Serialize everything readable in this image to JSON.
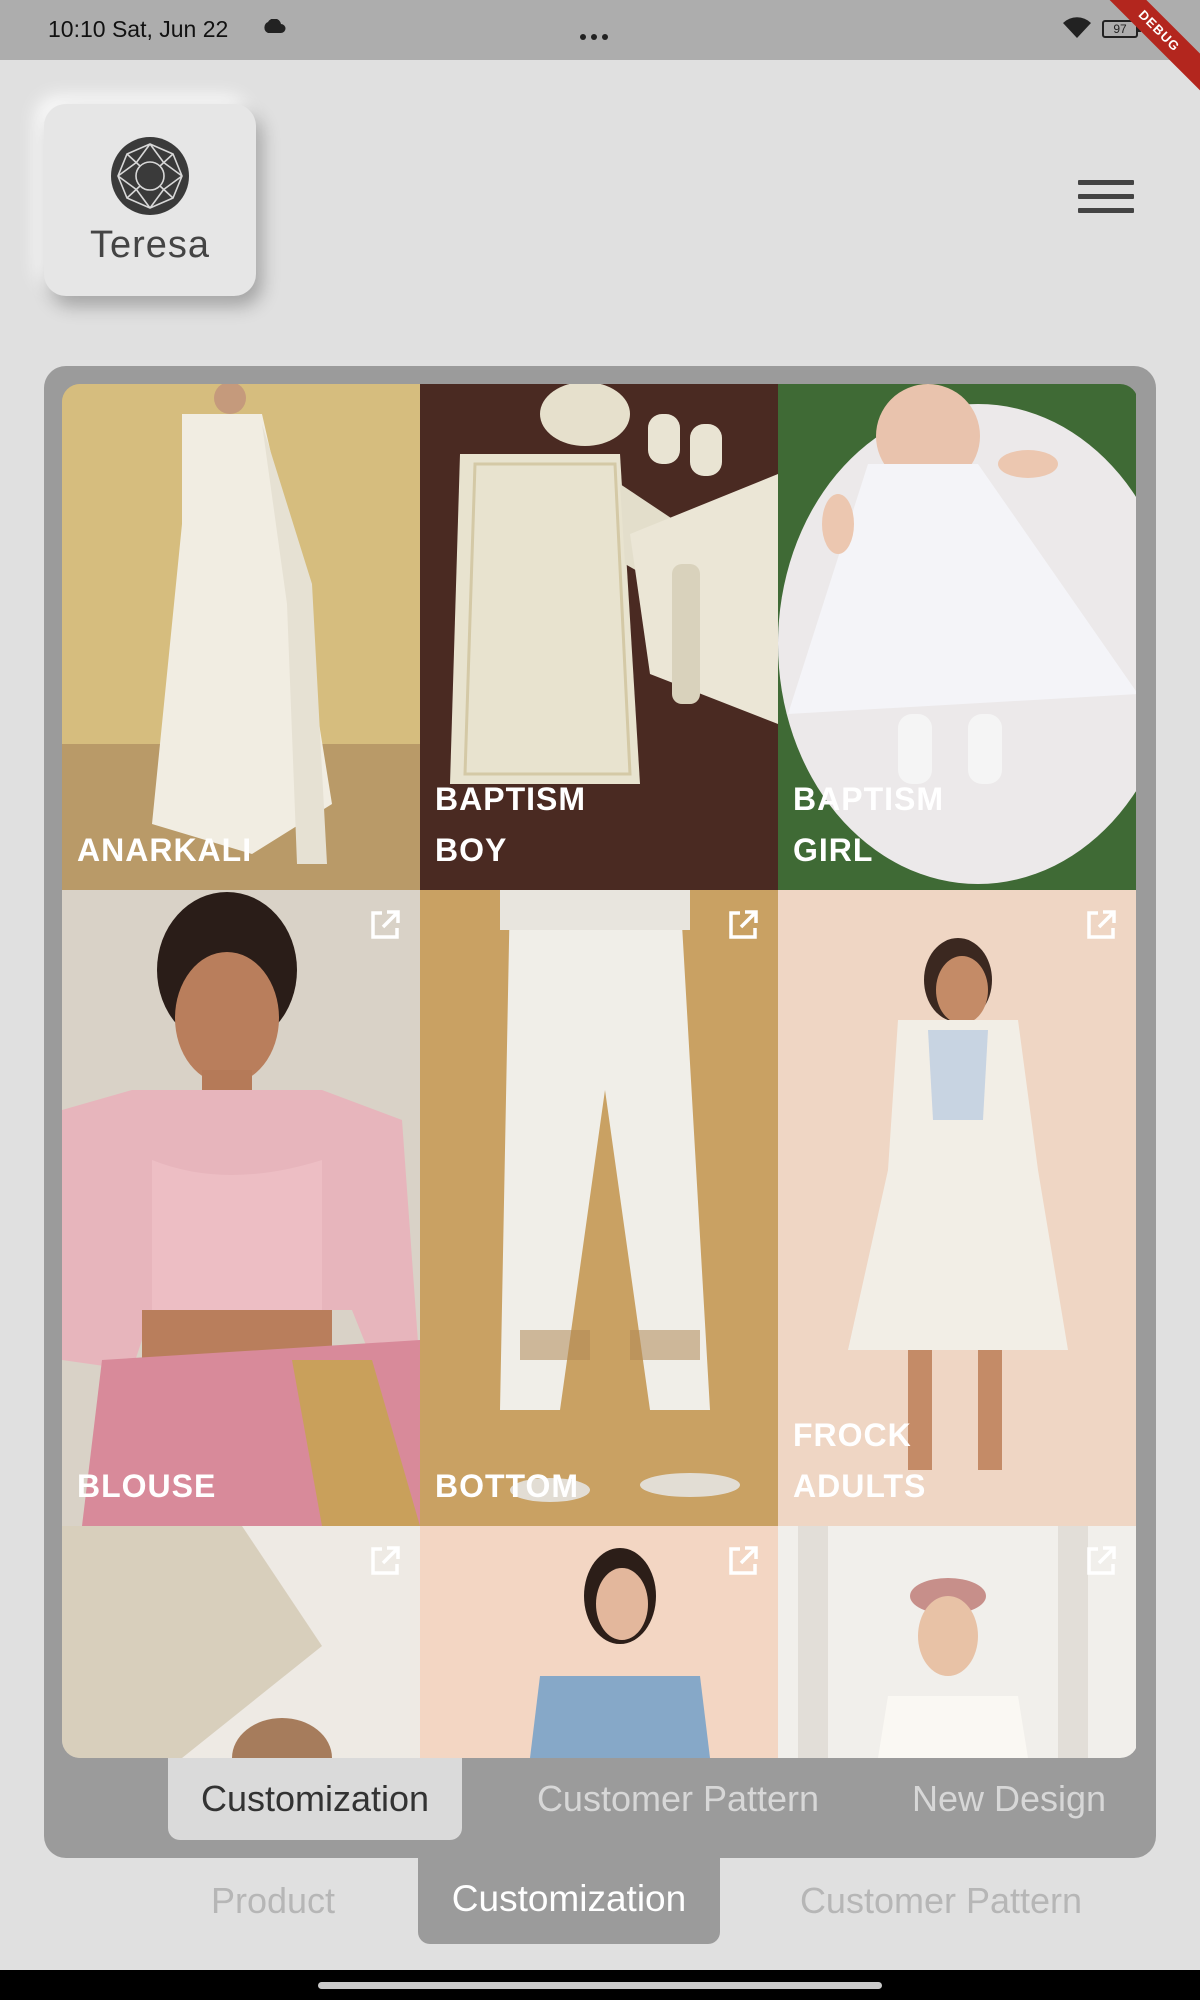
{
  "status_bar": {
    "time": "10:10  Sat, Jun 22",
    "battery": "97",
    "debug": "DEBUG"
  },
  "header": {
    "logo_text": "Teresa",
    "logo_icon": "gem-emblem-icon",
    "menu_icon": "hamburger-menu-icon"
  },
  "grid": {
    "open_icon": "open-in-new-icon",
    "tiles": [
      {
        "label": "ANARKALI"
      },
      {
        "label": "BAPTISM\nBOY"
      },
      {
        "label": "BAPTISM\nGIRL"
      },
      {
        "label": "BLOUSE"
      },
      {
        "label": "BOTTOM"
      },
      {
        "label": "FROCK\nADULTS"
      },
      {
        "label": ""
      },
      {
        "label": ""
      },
      {
        "label": ""
      }
    ]
  },
  "inner_tabs": {
    "active": "Customization",
    "items": [
      "Customization",
      "Customer Pattern",
      "New Design"
    ]
  },
  "outer_tabs": {
    "active": "Customization",
    "items": [
      "Product",
      "Customization",
      "Customer Pattern"
    ]
  },
  "colors": {
    "background": "#e0e0e0",
    "panel": "#9b9b9b",
    "status_bar": "#adadad",
    "debug_ribbon": "#b3261e"
  }
}
